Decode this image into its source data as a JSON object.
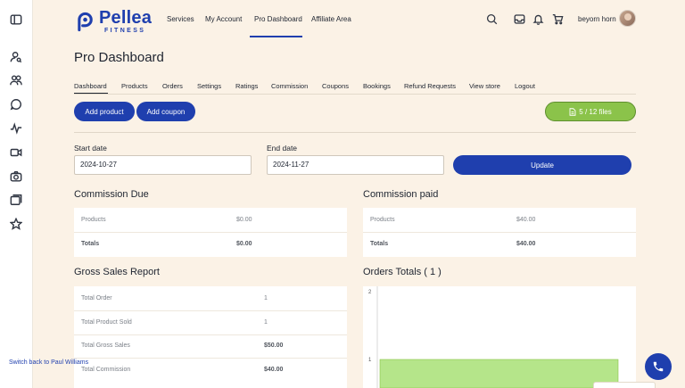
{
  "brand": {
    "name": "Pellea",
    "sub": "FITNESS",
    "color": "#1f3fae"
  },
  "nav": {
    "services": "Services",
    "my_account": "My Account",
    "pro_dashboard": "Pro Dashboard",
    "affiliate_area": "Affiliate Area",
    "active": "pro_dashboard"
  },
  "user": {
    "name": "beyorn horn"
  },
  "page_title": "Pro Dashboard",
  "tabs": [
    "Dashboard",
    "Products",
    "Orders",
    "Settings",
    "Ratings",
    "Commission",
    "Coupons",
    "Bookings",
    "Refund Requests",
    "View store",
    "Logout"
  ],
  "actions": {
    "add_product": "Add product",
    "add_coupon": "Add coupon",
    "files": "5 / 12 files"
  },
  "filters": {
    "start_label": "Start date",
    "start_value": "2024-10-27",
    "end_label": "End date",
    "end_value": "2024-11-27",
    "update": "Update"
  },
  "commission_due": {
    "title": "Commission Due",
    "rows": [
      {
        "label": "Products",
        "value": "$0.00"
      },
      {
        "label": "Totals",
        "value": "$0.00"
      }
    ]
  },
  "commission_paid": {
    "title": "Commission paid",
    "rows": [
      {
        "label": "Products",
        "value": "$40.00"
      },
      {
        "label": "Totals",
        "value": "$40.00"
      }
    ]
  },
  "gross_sales": {
    "title": "Gross Sales Report",
    "rows": [
      {
        "label": "Total Order",
        "value": "1"
      },
      {
        "label": "Total Product Sold",
        "value": "1"
      },
      {
        "label": "Total Gross Sales",
        "value": "$50.00"
      },
      {
        "label": "Total Commission",
        "value": "$40.00"
      }
    ]
  },
  "orders_totals": {
    "title": "Orders Totals ( 1 )"
  },
  "chart_data": {
    "type": "bar",
    "categories": [
      ""
    ],
    "values": [
      1
    ],
    "ylim": [
      0,
      2
    ],
    "yticks": [
      "2",
      "1"
    ],
    "color": "#b5e58a"
  },
  "switch_back": "Switch back to Paul Williams",
  "colors": {
    "accent": "#1f3fae",
    "success": "#8bc34a",
    "background": "#fbf2e6"
  }
}
